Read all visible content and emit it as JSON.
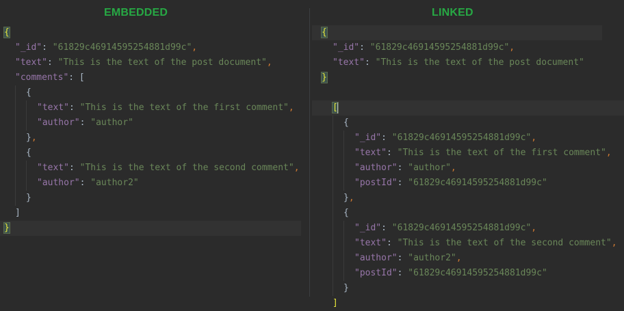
{
  "embedded": {
    "title": "EMBEDDED",
    "id_key": "\"_id\"",
    "id_value": "\"61829c46914595254881d99c\"",
    "text_key": "\"text\"",
    "text_value": "\"This is the text of the post document\"",
    "comments_key": "\"comments\"",
    "comments": [
      {
        "text_key": "\"text\"",
        "text_value": "\"This is the text of the first comment\"",
        "author_key": "\"author\"",
        "author_value": "\"author\""
      },
      {
        "text_key": "\"text\"",
        "text_value": "\"This is the text of the second comment\"",
        "author_key": "\"author\"",
        "author_value": "\"author2\""
      }
    ]
  },
  "linked": {
    "title": "LINKED",
    "post": {
      "id_key": "\"_id\"",
      "id_value": "\"61829c46914595254881d99c\"",
      "text_key": "\"text\"",
      "text_value": "\"This is the text of the post document\""
    },
    "comments": [
      {
        "id_key": "\"_id\"",
        "id_value": "\"61829c46914595254881d99c\"",
        "text_key": "\"text\"",
        "text_value": "\"This is the text of the first comment\"",
        "author_key": "\"author\"",
        "author_value": "\"author\"",
        "postid_key": "\"postId\"",
        "postid_value": "\"61829c46914595254881d99c\""
      },
      {
        "id_key": "\"_id\"",
        "id_value": "\"61829c46914595254881d99c\"",
        "text_key": "\"text\"",
        "text_value": "\"This is the text of the second comment\"",
        "author_key": "\"author\"",
        "author_value": "\"author2\"",
        "postid_key": "\"postId\"",
        "postid_value": "\"61829c46914595254881d99c\""
      }
    ]
  },
  "colors": {
    "background": "#2b2b2b",
    "title_green": "#27a844",
    "json_key": "#9876aa",
    "json_string": "#6a8759",
    "json_comma": "#cc7832",
    "bracket_match": "#e8e83a"
  }
}
